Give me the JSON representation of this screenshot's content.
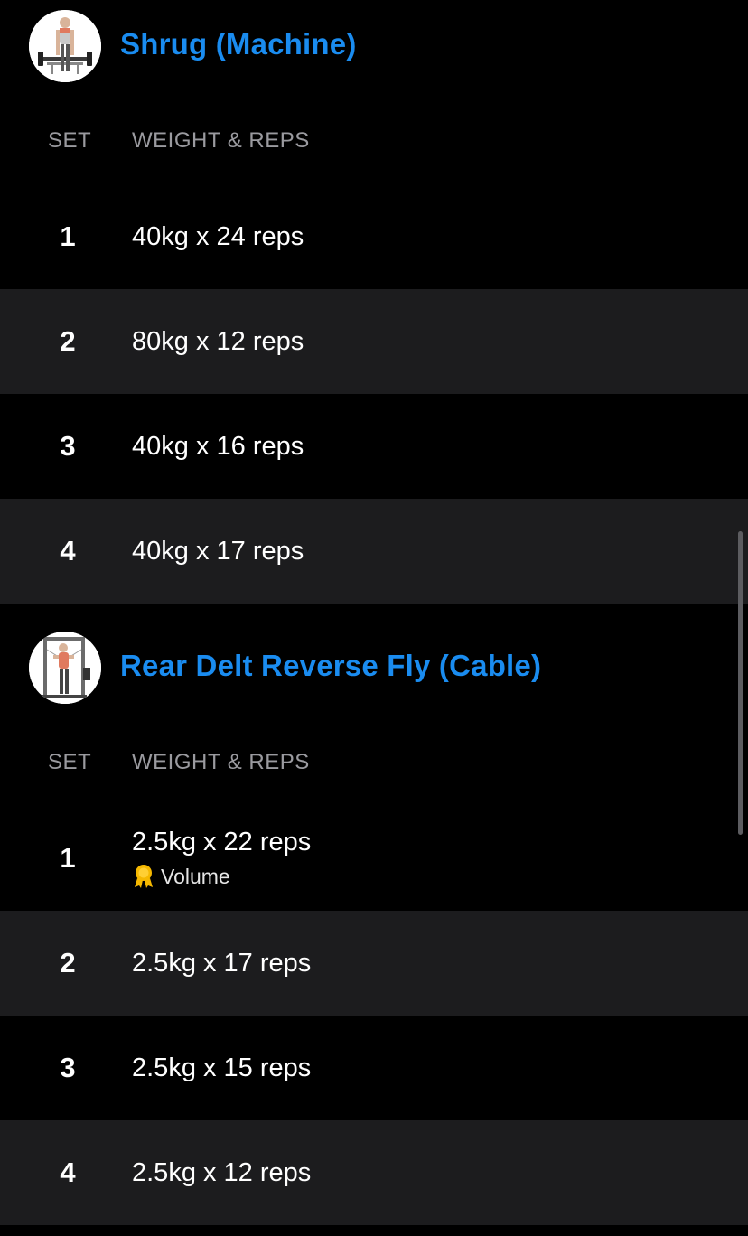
{
  "exercises": [
    {
      "title": "Shrug (Machine)",
      "thumbnail_icon": "shrug-machine-illustration",
      "columns": {
        "set": "SET",
        "weight_reps": "WEIGHT & REPS"
      },
      "sets": [
        {
          "number": "1",
          "value": "40kg x 24 reps"
        },
        {
          "number": "2",
          "value": "80kg x 12 reps"
        },
        {
          "number": "3",
          "value": "40kg x 16 reps"
        },
        {
          "number": "4",
          "value": "40kg x 17 reps"
        }
      ]
    },
    {
      "title": "Rear Delt Reverse Fly (Cable)",
      "thumbnail_icon": "cable-fly-illustration",
      "columns": {
        "set": "SET",
        "weight_reps": "WEIGHT & REPS"
      },
      "sets": [
        {
          "number": "1",
          "value": "2.5kg x 22 reps",
          "badge": "Volume",
          "badge_icon": "medal-icon"
        },
        {
          "number": "2",
          "value": "2.5kg x 17 reps"
        },
        {
          "number": "3",
          "value": "2.5kg x 15 reps"
        },
        {
          "number": "4",
          "value": "2.5kg x 12 reps"
        }
      ]
    }
  ],
  "colors": {
    "background": "#000000",
    "row_alt": "#1c1c1e",
    "accent": "#1a8cf0",
    "header_text": "#9a9a9f",
    "medal": "#f5b800"
  }
}
